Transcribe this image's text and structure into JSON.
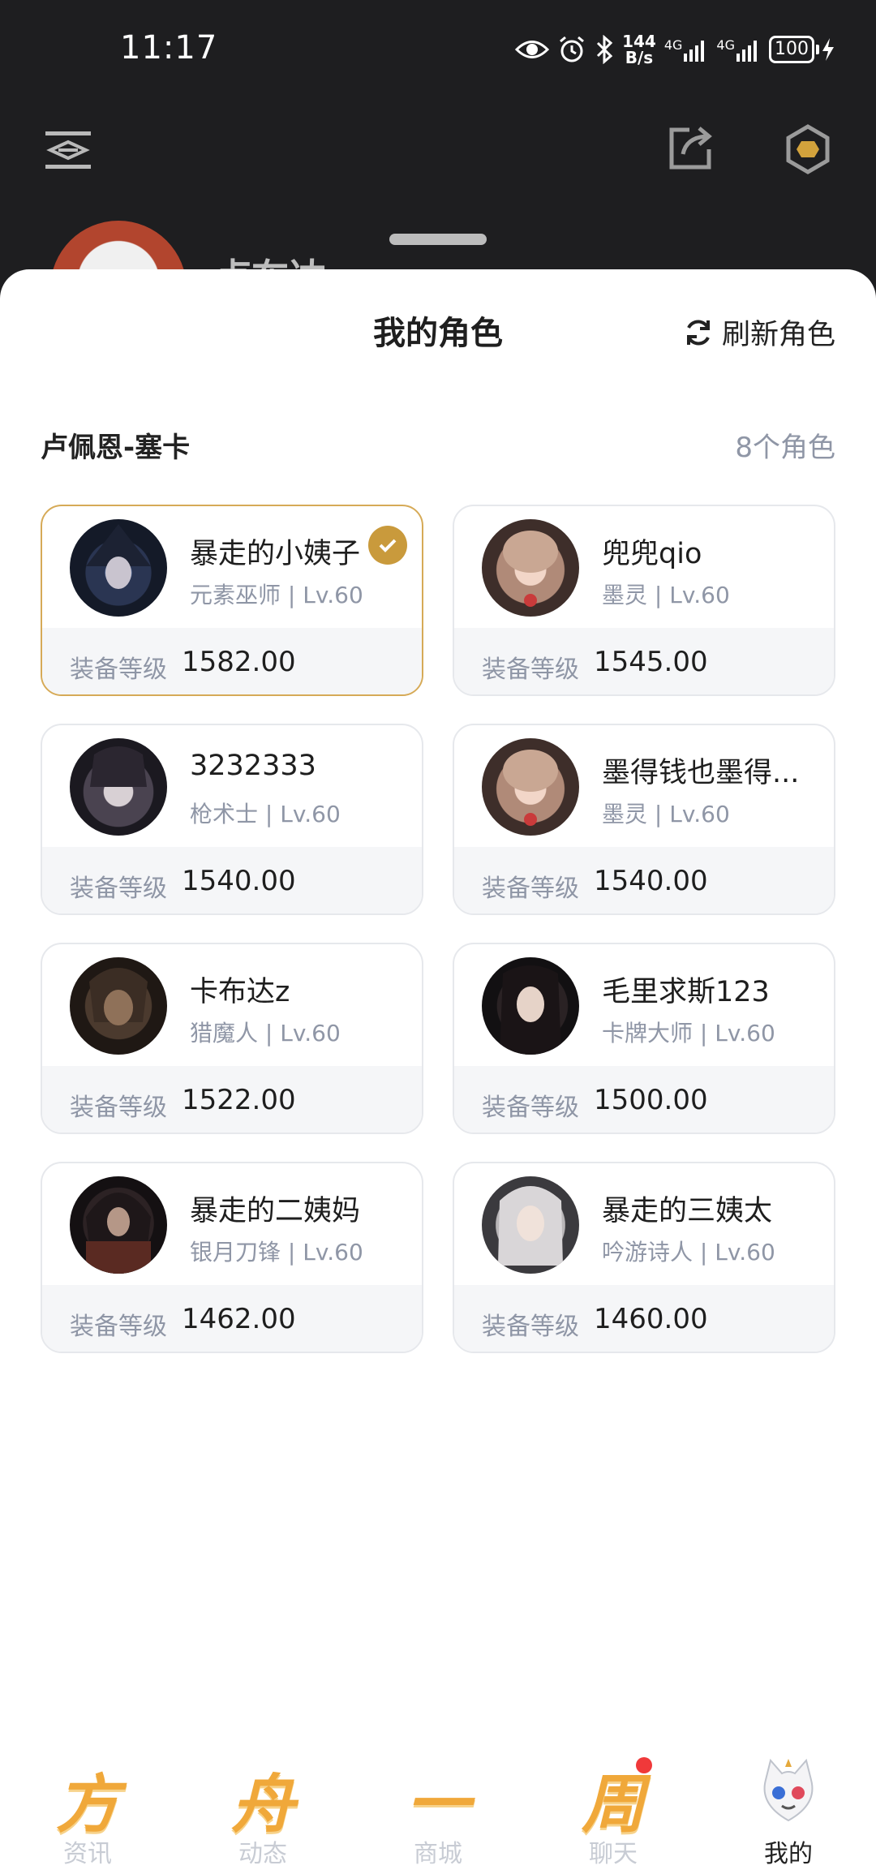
{
  "status_bar": {
    "time": "11:17",
    "speed_value": "144",
    "speed_unit": "B/s",
    "net1": "4G",
    "net2": "4G",
    "battery": "100"
  },
  "header": {
    "peek_name": "卢布达"
  },
  "sheet": {
    "title": "我的角色",
    "refresh_label": "刷新角色",
    "server_name": "卢佩恩-塞卡",
    "role_count": "8个角色",
    "gear_label": "装备等级",
    "characters": [
      {
        "name": "暴走的小姨子",
        "class_level": "元素巫师 | Lv.60",
        "gear_score": "1582.00",
        "selected": true
      },
      {
        "name": "兜兜qio",
        "class_level": "墨灵 | Lv.60",
        "gear_score": "1545.00",
        "selected": false
      },
      {
        "name": "3232333",
        "class_level": "枪术士 | Lv.60",
        "gear_score": "1540.00",
        "selected": false
      },
      {
        "name": "墨得钱也墨得...",
        "class_level": "墨灵 | Lv.60",
        "gear_score": "1540.00",
        "selected": false
      },
      {
        "name": "卡布达z",
        "class_level": "猎魔人 | Lv.60",
        "gear_score": "1522.00",
        "selected": false
      },
      {
        "name": "毛里求斯123",
        "class_level": "卡牌大师 | Lv.60",
        "gear_score": "1500.00",
        "selected": false
      },
      {
        "name": "暴走的二姨妈",
        "class_level": "银月刀锋 | Lv.60",
        "gear_score": "1462.00",
        "selected": false
      },
      {
        "name": "暴走的三姨太",
        "class_level": "吟游诗人 | Lv.60",
        "gear_score": "1460.00",
        "selected": false
      }
    ]
  },
  "bottom_nav": {
    "items": [
      {
        "glyph": "方",
        "label": "资讯"
      },
      {
        "glyph": "舟",
        "label": "动态"
      },
      {
        "glyph": "一",
        "label": "商城"
      },
      {
        "glyph": "周",
        "label": "聊天"
      },
      {
        "glyph": "",
        "label": "我的"
      }
    ]
  },
  "colors": {
    "accent_gold": "#c99a3c",
    "selected_border": "#d6aa57",
    "muted_text": "#8f96a6",
    "notification_red": "#f0393a"
  }
}
